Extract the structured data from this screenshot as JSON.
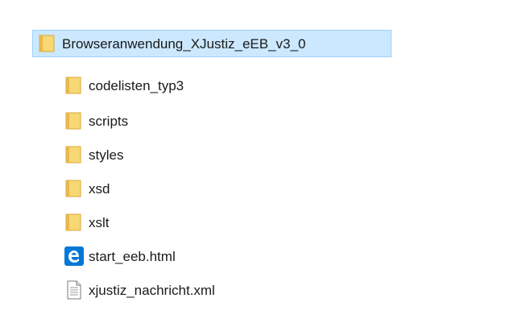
{
  "tree": {
    "root": {
      "label": "Browseranwendung_XJustiz_eEB_v3_0",
      "icon": "folder-icon",
      "selected": true
    },
    "children": [
      {
        "label": "codelisten_typ3",
        "icon": "folder-icon"
      },
      {
        "label": "scripts",
        "icon": "folder-icon"
      },
      {
        "label": "styles",
        "icon": "folder-icon"
      },
      {
        "label": "xsd",
        "icon": "folder-icon"
      },
      {
        "label": "xslt",
        "icon": "folder-icon"
      },
      {
        "label": "start_eeb.html",
        "icon": "edge-html-icon"
      },
      {
        "label": "xjustiz_nachricht.xml",
        "icon": "document-icon"
      }
    ]
  },
  "colors": {
    "selection_bg": "#cce8ff",
    "selection_border": "#99d1ff",
    "folder": "#f8d775",
    "folder_dark": "#e8b84a",
    "edge_blue": "#0078d7"
  }
}
